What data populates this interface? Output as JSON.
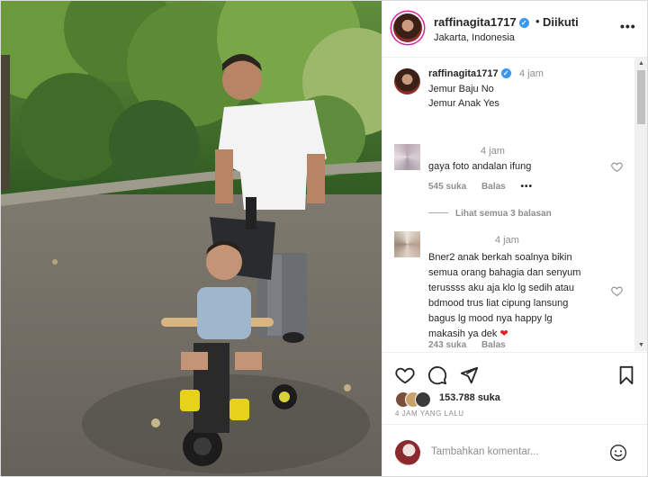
{
  "post": {
    "username": "raffinagita1717",
    "verified_mark": "✓",
    "follow_separator": "•",
    "follow_status": "Diikuti",
    "location": "Jakarta, Indonesia",
    "more_glyph": "•••"
  },
  "caption": {
    "username": "raffinagita1717",
    "time": "4 jam",
    "lines": [
      "Jemur Baju No",
      "Jemur Anak Yes"
    ]
  },
  "comments": [
    {
      "time": "4 jam",
      "text": "gaya foto andalan ifung",
      "likes": "545 suka",
      "reply": "Balas",
      "more": "•••",
      "view_replies": "Lihat semua 3 balasan"
    },
    {
      "time": "4 jam",
      "lines": [
        "Bner2 anak berkah soalnya bikin",
        "semua orang bahagia dan senyum",
        "terussss aku aja klo lg sedih atau",
        "bdmood trus liat cipung lansung",
        "bagus lg mood nya happy lg",
        "makasih ya dek"
      ],
      "emoji": "❤",
      "likes": "243 suka",
      "reply": "Balas"
    }
  ],
  "scrollbar": {
    "up": "▲",
    "down": "▼"
  },
  "actions": {
    "likes": "153.788 suka",
    "time_ago": "4 JAM YANG LALU",
    "icons": [
      "heart-icon",
      "comment-icon",
      "share-icon",
      "bookmark-icon"
    ]
  },
  "add_comment": {
    "placeholder": "Tambahkan komentar..."
  },
  "colors": {
    "story_ring": "#d6249f",
    "verified": "#3897f0",
    "heart_emoji": "#ed1c24",
    "muted_text": "#8e8e8e"
  }
}
